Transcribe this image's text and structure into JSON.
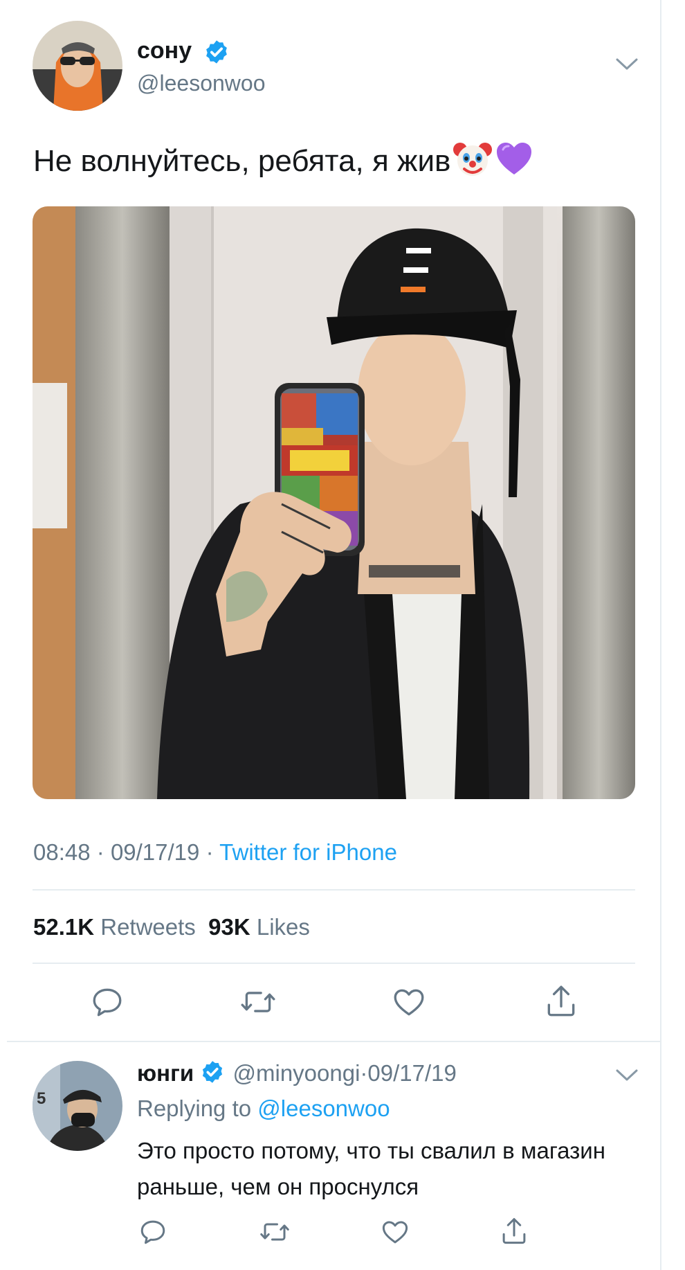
{
  "tweet": {
    "author_name": "сону",
    "author_handle": "@leesonwoo",
    "text": "Не волнуйтесь, ребята, я жив",
    "emojis": [
      "clown-face-emoji",
      "purple-heart-emoji"
    ],
    "time": "08:48",
    "date": "09/17/19",
    "separator": "·",
    "source": "Twitter for iPhone",
    "retweets_count": "52.1K",
    "retweets_label": "Retweets",
    "likes_count": "93K",
    "likes_label": "Likes"
  },
  "actions": [
    "reply-icon",
    "retweet-icon",
    "like-icon",
    "share-icon"
  ],
  "reply": {
    "author_name": "юнги",
    "author_handle": "@minyoongi",
    "separator": "·",
    "date": "09/17/19",
    "replying_prefix": "Replying to",
    "replying_to": "@leesonwoo",
    "text": "Это просто потому, что ты свалил в магазин раньше, чем он проснулся"
  },
  "colors": {
    "accent": "#1da1f2",
    "secondary_text": "#657786",
    "primary_text": "#14171a",
    "divider": "#e6ecf0"
  }
}
